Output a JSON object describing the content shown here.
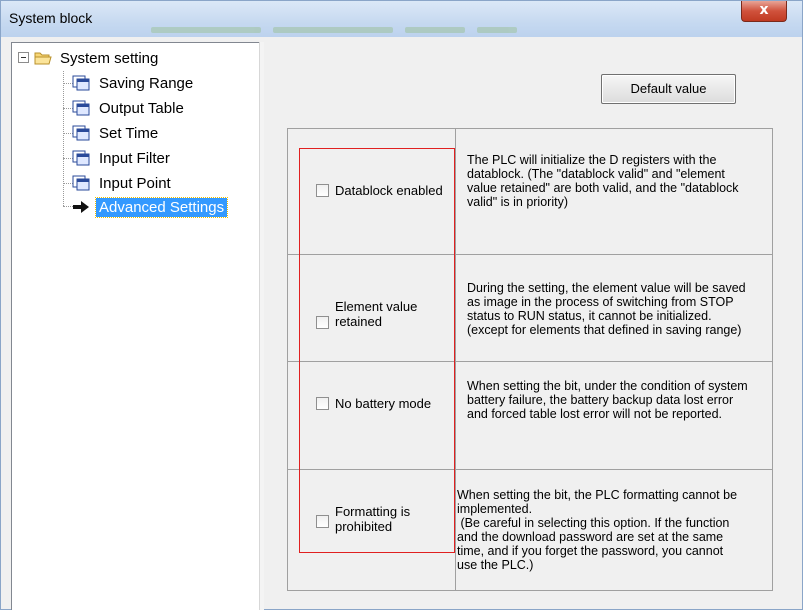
{
  "window": {
    "title": "System block",
    "close_label": "x"
  },
  "tree": {
    "root_label": "System setting",
    "items": [
      {
        "label": "Saving Range"
      },
      {
        "label": "Output Table"
      },
      {
        "label": "Set Time"
      },
      {
        "label": "Input Filter"
      },
      {
        "label": "Input Point"
      },
      {
        "label": "Advanced Settings",
        "selected": true
      }
    ]
  },
  "toolbar": {
    "default_label": "Default value"
  },
  "options": [
    {
      "label": "Datablock enabled",
      "checked": false,
      "description_lines": [
        "The PLC will initialize the D registers with the",
        "datablock. (The \"datablock valid\" and \"element",
        "value retained\" are both valid, and the \"datablock",
        "valid\" is in priority)"
      ]
    },
    {
      "label_lines": [
        "Element value",
        "retained"
      ],
      "checked": false,
      "description_lines": [
        "During the setting, the element value will be saved",
        "as image in the process of switching from STOP",
        "status to RUN status, it cannot be initialized.",
        "(except for elements that defined in saving range)"
      ]
    },
    {
      "label": "No battery mode",
      "checked": false,
      "description_lines": [
        "When setting the bit, under the condition of system",
        "battery failure, the battery backup data lost error",
        "and forced table lost error will not be reported."
      ]
    },
    {
      "label_lines": [
        "Formatting is",
        "prohibited"
      ],
      "checked": false,
      "description_lines": [
        "When setting the bit, the PLC formatting cannot be",
        "implemented.",
        " (Be careful in selecting this option. If the function",
        "and the download password are set at the same",
        "time, and if you forget the password, you cannot",
        "use the PLC.)"
      ]
    }
  ],
  "colors": {
    "selection": "#3399ff",
    "highlight_box": "#e02020",
    "close_button": "#c03a22"
  },
  "icons": {
    "root": "folder-icon",
    "item": "page-icon",
    "selected_item": "arrow-icon"
  }
}
